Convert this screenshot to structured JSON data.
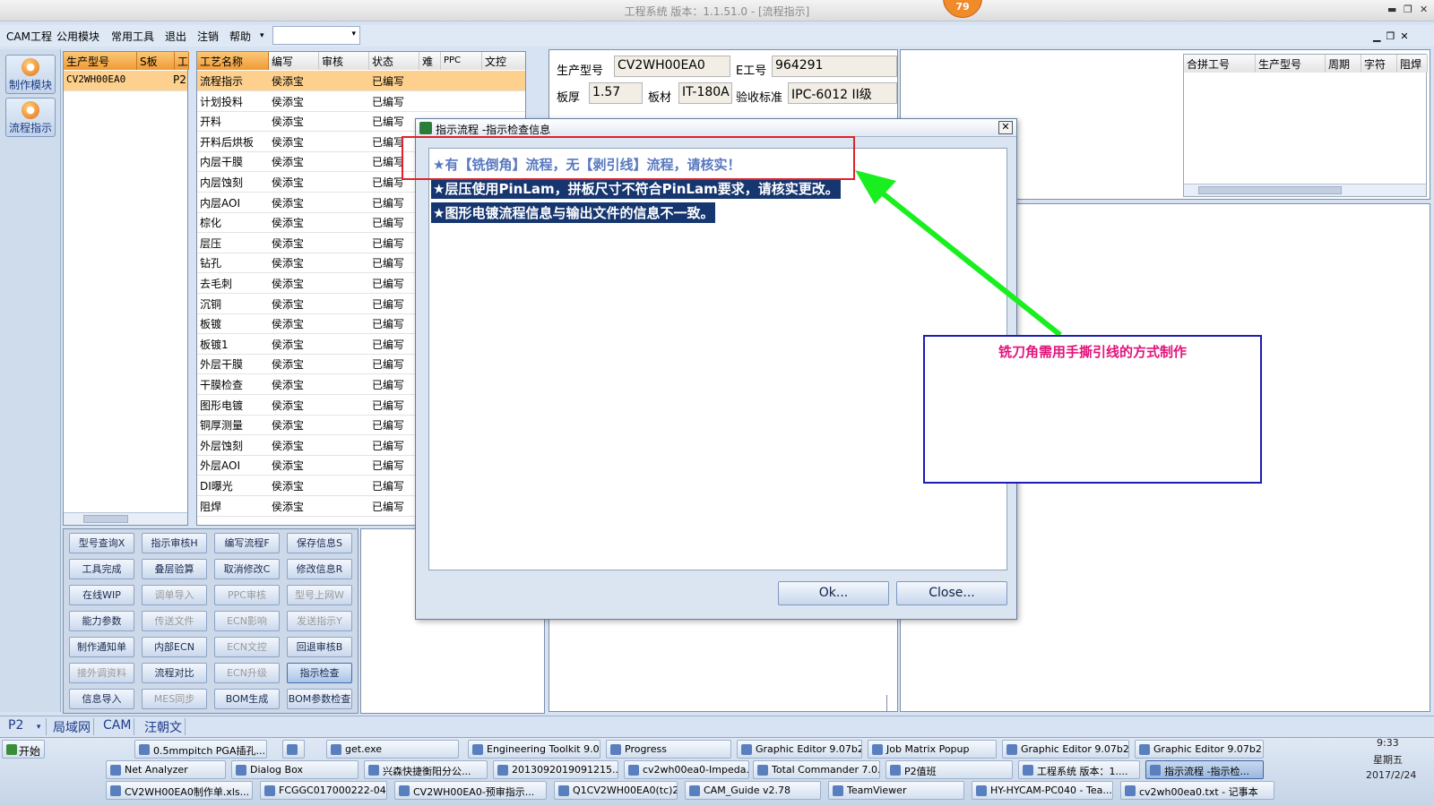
{
  "window": {
    "title": "工程系统   版本：1.1.51.0 - [流程指示]",
    "badge": "79",
    "min": "▬",
    "max": "❐",
    "close": "✕"
  },
  "menubar": {
    "items": [
      "CAM工程",
      "公用模块",
      "常用工具",
      "退出",
      "注销",
      "帮助"
    ],
    "dropdown_arrow": "▾",
    "mdi_controls": "▁❐✕"
  },
  "leftbar": {
    "buttons": [
      "制作模块",
      "流程指示"
    ]
  },
  "panelA": {
    "headers": [
      "生产型号",
      "S板",
      "工"
    ],
    "rows": [
      [
        "CV2WH00EA0",
        "",
        "P2"
      ]
    ]
  },
  "panelB": {
    "headers": [
      "工艺名称",
      "编写",
      "审核",
      "状态",
      "难",
      "PPC",
      "文控"
    ],
    "rows": [
      [
        "流程指示",
        "侯添宝",
        "",
        "已编写"
      ],
      [
        "计划投料",
        "侯添宝",
        "",
        "已编写"
      ],
      [
        "开料",
        "侯添宝",
        "",
        "已编写"
      ],
      [
        "开料后烘板",
        "侯添宝",
        "",
        "已编写"
      ],
      [
        "内层干膜",
        "侯添宝",
        "",
        "已编写"
      ],
      [
        "内层蚀刻",
        "侯添宝",
        "",
        "已编写"
      ],
      [
        "内层AOI",
        "侯添宝",
        "",
        "已编写"
      ],
      [
        "棕化",
        "侯添宝",
        "",
        "已编写"
      ],
      [
        "层压",
        "侯添宝",
        "",
        "已编写"
      ],
      [
        "钻孔",
        "侯添宝",
        "",
        "已编写"
      ],
      [
        "去毛刺",
        "侯添宝",
        "",
        "已编写"
      ],
      [
        "沉铜",
        "侯添宝",
        "",
        "已编写"
      ],
      [
        "板镀",
        "侯添宝",
        "",
        "已编写"
      ],
      [
        "板镀1",
        "侯添宝",
        "",
        "已编写"
      ],
      [
        "外层干膜",
        "侯添宝",
        "",
        "已编写"
      ],
      [
        "干膜检查",
        "侯添宝",
        "",
        "已编写"
      ],
      [
        "图形电镀",
        "侯添宝",
        "",
        "已编写"
      ],
      [
        "铜厚测量",
        "侯添宝",
        "",
        "已编写"
      ],
      [
        "外层蚀刻",
        "侯添宝",
        "",
        "已编写"
      ],
      [
        "外层AOI",
        "侯添宝",
        "",
        "已编写"
      ],
      [
        "DI曝光",
        "侯添宝",
        "",
        "已编写"
      ],
      [
        "阻焊",
        "侯添宝",
        "",
        "已编写"
      ]
    ]
  },
  "function_buttons": [
    [
      "型号查询X",
      "指示审核H",
      "编写流程F",
      "保存信息S"
    ],
    [
      "工具完成",
      "叠层验算",
      "取消修改C",
      "修改信息R"
    ],
    [
      "在线WIP",
      "调单导入",
      "PPC审核",
      "型号上网W"
    ],
    [
      "能力参数",
      "传送文件",
      "ECN影响",
      "发送指示Y"
    ],
    [
      "制作通知单",
      "内部ECN",
      "ECN文控",
      "回退审核B"
    ],
    [
      "接外调资料",
      "流程对比",
      "ECN升级",
      "指示检查"
    ],
    [
      "信息导入",
      "MES同步",
      "BOM生成",
      "BOM参数检查"
    ]
  ],
  "disabled_buttons": [
    "调单导入",
    "PPC审核",
    "型号上网W",
    "传送文件",
    "ECN影响",
    "发送指示Y",
    "ECN文控",
    "接外调资料",
    "ECN升级",
    "MES同步"
  ],
  "info": {
    "model_label": "生产型号",
    "model_value": "CV2WH00EA0",
    "e_label": "E工号",
    "e_value": "964291",
    "thick_label": "板厚",
    "thick_value": "1.57",
    "material_label": "板材",
    "material_value": "IT-180A",
    "std_label": "验收标准",
    "std_value": "IPC-6012 II级"
  },
  "right_grid": {
    "headers": [
      "合拼工号",
      "生产型号",
      "周期",
      "字符",
      "阻焊"
    ]
  },
  "dialog": {
    "title": "指示流程 -指示检查信息",
    "close_glyph": "✕",
    "lines": [
      "★有【铣倒角】流程，无【剥引线】流程，请核实！",
      "★层压使用PinLam，拼板尺寸不符合PinLam要求，请核实更改。",
      "★图形电镀流程信息与输出文件的信息不一致。"
    ],
    "ok": "Ok...",
    "close": "Close..."
  },
  "annotation": {
    "note": "铣刀角需用手撕引线的方式制作",
    "arrow_color": "#19ef1f",
    "box_color": "#e0222a",
    "note_border": "#1b1db5"
  },
  "statusbar": {
    "tabs": [
      "P2",
      "局域网",
      "CAM",
      "汪朝文"
    ],
    "p2_arrow": "▾"
  },
  "taskbar": {
    "start": "开始",
    "row1": [
      "0.5mmpitch PGA插孔...",
      "",
      "get.exe",
      "Engineering Toolkit 9.0...",
      "Progress",
      "Graphic Editor 9.07b2 ...",
      "Job Matrix Popup",
      "Graphic Editor 9.07b2 ...",
      "Graphic Editor 9.07b2 ..."
    ],
    "row2": [
      "Net Analyzer",
      "Dialog Box",
      "兴森快捷衡阳分公...",
      "2013092019091215....",
      "cv2wh00ea0-Impeda...",
      "Total Commander 7.0...",
      "P2值班",
      "工程系统  版本：1....",
      "指示流程 -指示检..."
    ],
    "row3": [
      "CV2WH00EA0制作单.xls...",
      "FCGGC017000222-04(C...",
      "CV2WH00EA0-预审指示...",
      "Q1CV2WH00EA0(tc)201...",
      "CAM_Guide v2.78",
      "TeamViewer",
      "HY-HYCAM-PC040 - Tea...",
      "cv2wh00ea0.txt - 记事本"
    ]
  },
  "tray": {
    "time": "9:33",
    "weekday": "星期五",
    "date": "2017/2/24"
  }
}
